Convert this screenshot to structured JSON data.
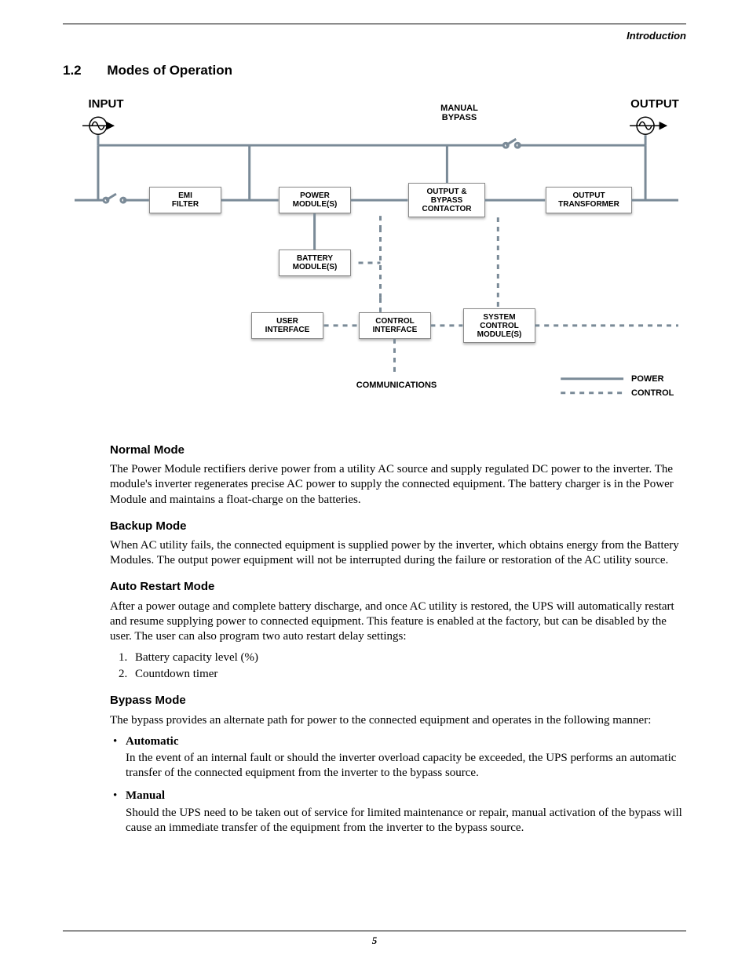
{
  "breadcrumb": "Introduction",
  "section_number": "1.2",
  "section_title": "Modes of Operation",
  "diagram": {
    "input_label": "INPUT",
    "output_label": "OUTPUT",
    "manual_bypass": "MANUAL\nBYPASS",
    "communications": "COMMUNICATIONS",
    "legend_power": "POWER",
    "legend_control": "CONTROL",
    "row1": {
      "emi_filter": "EMI\nFILTER",
      "power_modules": "POWER\nMODULE(S)",
      "output_bypass_contactor": "OUTPUT &\nBYPASS\nCONTACTOR",
      "output_transformer": "OUTPUT\nTRANSFORMER"
    },
    "row2": {
      "battery_modules": "BATTERY\nMODULE(S)"
    },
    "row3": {
      "user_interface": "USER\nINTERFACE",
      "control_interface": "CONTROL\nINTERFACE",
      "system_control_modules": "SYSTEM\nCONTROL\nMODULE(S)"
    }
  },
  "normal": {
    "heading": "Normal Mode",
    "body": "The Power Module rectifiers derive power from a utility AC source and supply regulated DC power to the inverter. The module's inverter regenerates precise AC power to supply the connected equipment. The battery charger is in the Power Module and maintains a float-charge on the batteries."
  },
  "backup": {
    "heading": "Backup Mode",
    "body": "When AC utility fails, the connected equipment is supplied power by the inverter, which obtains energy from the Battery Modules. The output power equipment will not be interrupted during the failure or restoration of the AC utility source."
  },
  "auto": {
    "heading": "Auto Restart Mode",
    "body": "After a power outage and complete battery discharge, and once AC utility is restored, the UPS will automatically restart and resume supplying power to connected equipment. This feature is enabled at the factory, but can be disabled by the user. The user can also program two auto restart delay settings:",
    "items": [
      "Battery capacity level (%)",
      "Countdown timer"
    ]
  },
  "bypass": {
    "heading": "Bypass Mode",
    "lead": "The bypass provides an alternate path for power to the connected equipment and operates in the following manner:",
    "automatic": {
      "label": "Automatic",
      "body": "In the event of an internal fault or should the inverter overload capacity be exceeded, the UPS performs an automatic transfer of the connected equipment from the inverter to the bypass source."
    },
    "manual": {
      "label": "Manual",
      "body": "Should the UPS need to be taken out of service for limited maintenance or repair, manual activation of the bypass will cause an immediate transfer of the equipment from the inverter to the bypass source."
    }
  },
  "page_number": "5"
}
